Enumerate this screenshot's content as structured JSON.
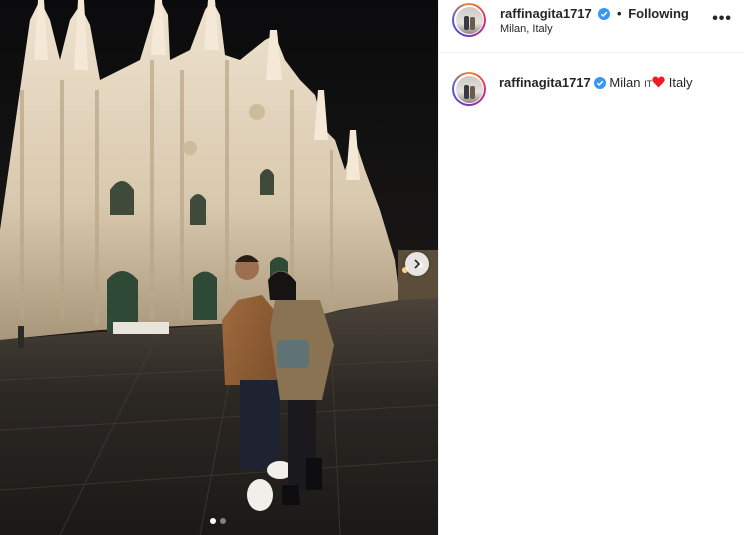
{
  "post": {
    "username": "raffinagita1717",
    "follow_separator": "•",
    "follow_status": "Following",
    "location": "Milan, Italy",
    "more_label": "•••",
    "caption": {
      "text_before": "Milan",
      "flag": "IT",
      "text_after": "Italy"
    },
    "carousel": {
      "total": 2,
      "current": 1
    }
  },
  "colors": {
    "verified": "#3897f0",
    "heart": "#ed1c24",
    "divider": "#efefef"
  },
  "icons": {
    "verified": "verified-badge-icon",
    "heart": "heart-emoji-icon",
    "next": "chevron-right-icon",
    "more": "more-options-icon"
  }
}
